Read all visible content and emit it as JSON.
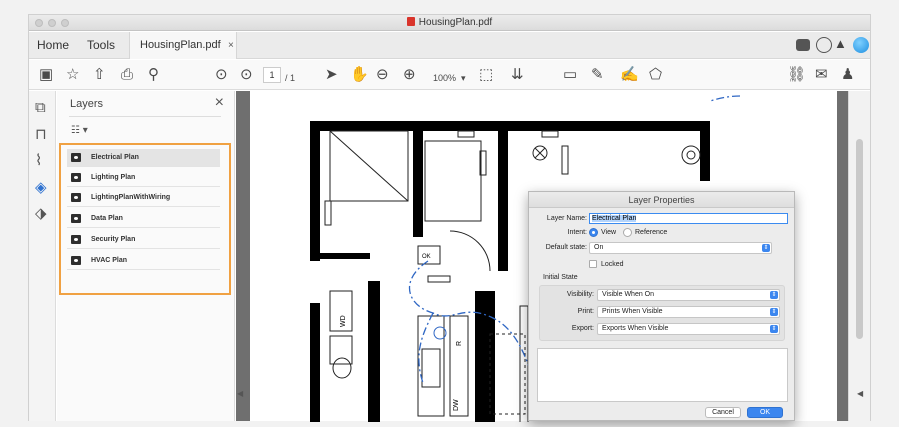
{
  "window": {
    "title": "HousingPlan.pdf"
  },
  "tabs": {
    "home": "Home",
    "tools": "Tools",
    "document": "HousingPlan.pdf",
    "close": "×"
  },
  "toolbar": {
    "page_current": "1",
    "page_total": "/ 1",
    "zoom": "100%"
  },
  "layers_panel": {
    "title": "Layers",
    "close": "×",
    "items": [
      {
        "label": "Electrical Plan"
      },
      {
        "label": "Lighting Plan"
      },
      {
        "label": "LightingPlanWithWiring"
      },
      {
        "label": "Data Plan"
      },
      {
        "label": "Security Plan"
      },
      {
        "label": "HVAC Plan"
      }
    ]
  },
  "floor_plan": {
    "label_wd": "WD",
    "label_r": "R",
    "label_dw": "DW",
    "label_ok": "OK"
  },
  "dialog": {
    "title": "Layer Properties",
    "layer_name_label": "Layer Name:",
    "layer_name_value": "Electrical Plan",
    "intent_label": "Intent:",
    "intent_view": "View",
    "intent_reference": "Reference",
    "default_state_label": "Default state:",
    "default_state_value": "On",
    "locked_label": "Locked",
    "initial_state_label": "Initial State",
    "visibility_label": "Visibility:",
    "visibility_value": "Visible When On",
    "print_label": "Print:",
    "print_value": "Prints When Visible",
    "export_label": "Export:",
    "export_value": "Exports When Visible",
    "cancel_label": "Cancel",
    "ok_label": "OK"
  },
  "colors": {
    "accent": "#3b86ef",
    "highlight": "#f0a142",
    "pdf_red": "#d9342b"
  }
}
